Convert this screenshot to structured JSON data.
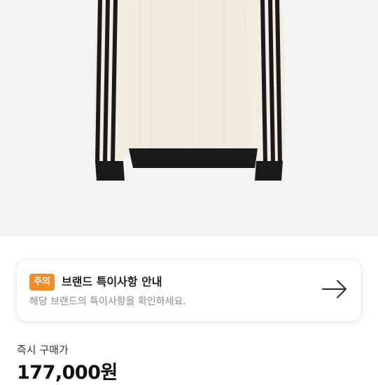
{
  "product": {
    "image_alt": "cream ribbed sweatshirt with black three stripes"
  },
  "notice": {
    "badge": "주의",
    "title": "브랜드 특이사항 안내",
    "subtitle": "해당 브랜드의 특이사항을 확인하세요.",
    "arrow_icon": "arrow-right-icon",
    "badge_color": "#f28c28"
  },
  "price": {
    "label": "즉시 구매가",
    "value": "177,000원"
  }
}
